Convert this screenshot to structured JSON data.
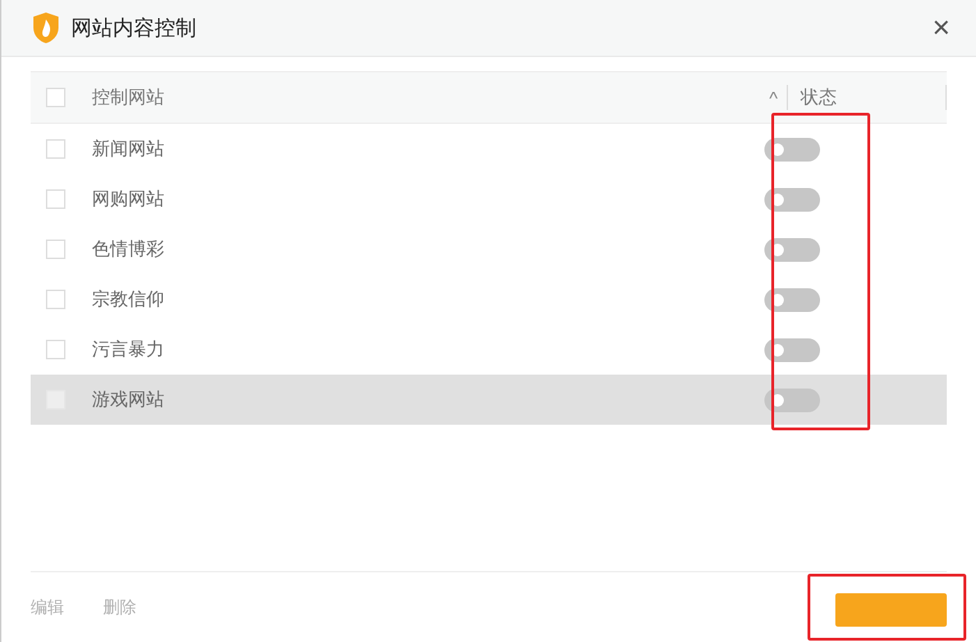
{
  "window": {
    "title": "网站内容控制",
    "close": "×"
  },
  "table": {
    "columns": [
      {
        "label": "控制网站",
        "sort": "^"
      },
      {
        "label": "状态"
      }
    ],
    "header_checked": false,
    "rows": [
      {
        "name": "新闻网站",
        "checked": false,
        "on": false,
        "highlighted": false
      },
      {
        "name": "网购网站",
        "checked": false,
        "on": false,
        "highlighted": false
      },
      {
        "name": "色情博彩",
        "checked": false,
        "on": false,
        "highlighted": false
      },
      {
        "name": "宗教信仰",
        "checked": false,
        "on": false,
        "highlighted": false
      },
      {
        "name": "污言暴力",
        "checked": false,
        "on": false,
        "highlighted": false
      },
      {
        "name": "游戏网站",
        "checked": false,
        "on": false,
        "highlighted": true
      }
    ]
  },
  "footer": {
    "actions": [
      {
        "label": "编辑",
        "disabled": true
      },
      {
        "label": "删除",
        "disabled": true
      }
    ]
  }
}
